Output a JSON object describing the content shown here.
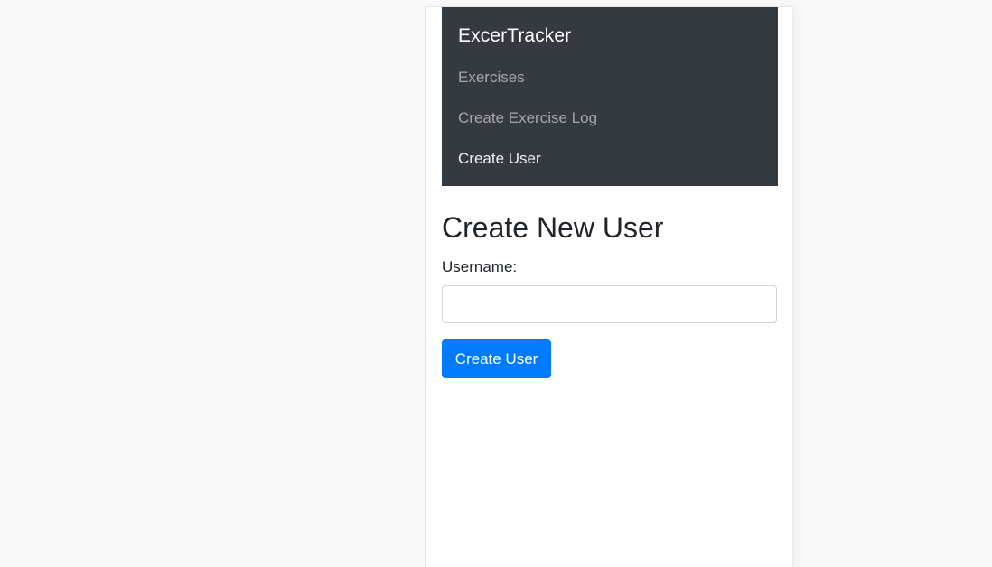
{
  "navbar": {
    "brand": "ExcerTracker",
    "links": [
      {
        "label": "Exercises",
        "active": false
      },
      {
        "label": "Create Exercise Log",
        "active": false
      },
      {
        "label": "Create User",
        "active": true
      }
    ]
  },
  "form": {
    "title": "Create New User",
    "username_label": "Username:",
    "username_value": "",
    "submit_label": "Create User"
  },
  "colors": {
    "navbar_bg": "#343a40",
    "primary": "#007bff",
    "page_bg": "#f9f9f9"
  }
}
